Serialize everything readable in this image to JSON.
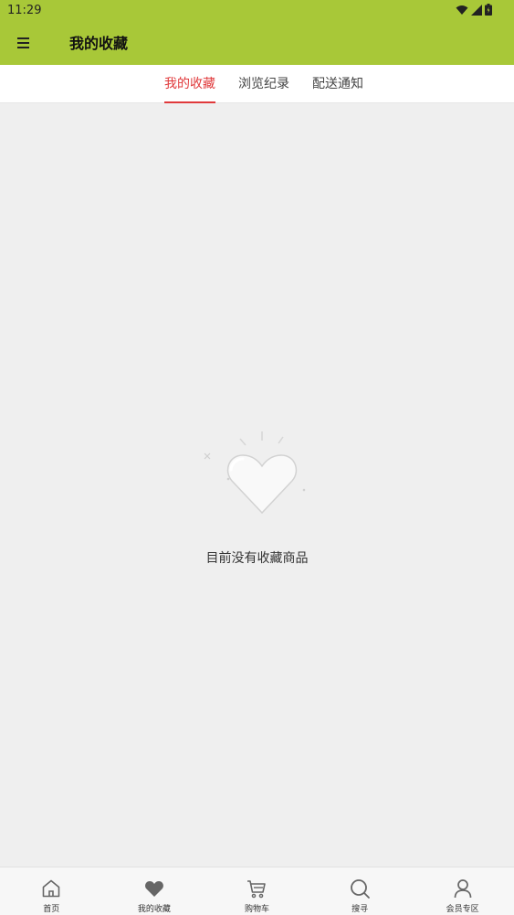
{
  "status_bar": {
    "time": "11:29"
  },
  "header": {
    "title": "我的收藏"
  },
  "tabs": [
    {
      "label": "我的收藏",
      "active": true
    },
    {
      "label": "浏览纪录",
      "active": false
    },
    {
      "label": "配送通知",
      "active": false
    }
  ],
  "empty_state": {
    "message": "目前没有收藏商品"
  },
  "bottom_nav": [
    {
      "label": "首页",
      "icon": "home-icon"
    },
    {
      "label": "我的收藏",
      "icon": "heart-icon"
    },
    {
      "label": "购物车",
      "icon": "cart-icon"
    },
    {
      "label": "搜寻",
      "icon": "search-icon"
    },
    {
      "label": "会员专区",
      "icon": "user-icon"
    }
  ],
  "colors": {
    "brand": "#a8c838",
    "active_tab": "#e0393b",
    "background": "#efefef"
  }
}
